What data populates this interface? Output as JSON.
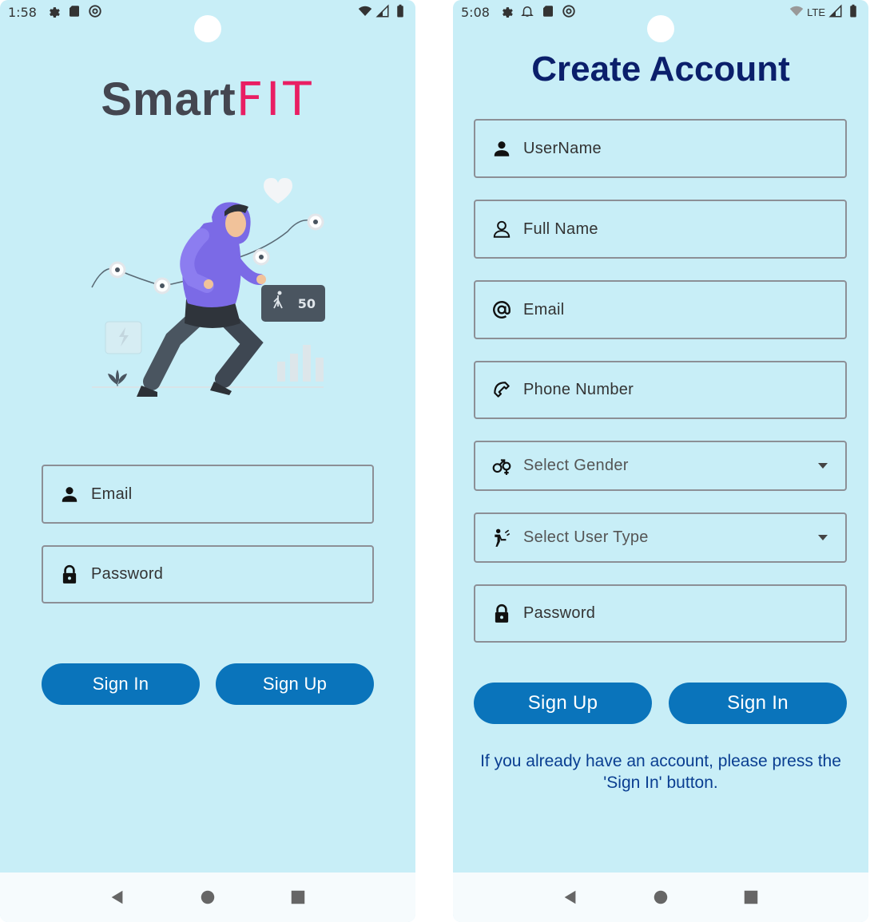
{
  "login": {
    "status_time": "1:58",
    "app_name_part1": "Smart",
    "app_name_part2": "FIT",
    "illustration_steps": "50",
    "email_label": "Email",
    "password_label": "Password",
    "sign_in_label": "Sign In",
    "sign_up_label": "Sign Up"
  },
  "signup": {
    "status_time": "5:08",
    "network": "LTE",
    "title": "Create Account",
    "username_label": "UserName",
    "fullname_label": "Full Name",
    "email_label": "Email",
    "phone_label": "Phone Number",
    "gender_label": "Select Gender",
    "usertype_label": "Select User Type",
    "password_label": "Password",
    "sign_up_label": "Sign Up",
    "sign_in_label": "Sign In",
    "hint": "If you already have an account, please press the 'Sign In' button."
  },
  "colors": {
    "background": "#c8eef7",
    "accent": "#e91e63",
    "button": "#0a74bb",
    "title": "#0b1f6b"
  },
  "icons": [
    "settings-icon",
    "sd-card-icon",
    "at-circle-icon",
    "bell-icon",
    "wifi-icon",
    "signal-icon",
    "battery-icon",
    "person-icon",
    "person-outline-icon",
    "at-icon",
    "phone-icon",
    "gender-icon",
    "user-type-icon",
    "lock-icon",
    "back-icon",
    "home-icon",
    "recents-icon"
  ]
}
